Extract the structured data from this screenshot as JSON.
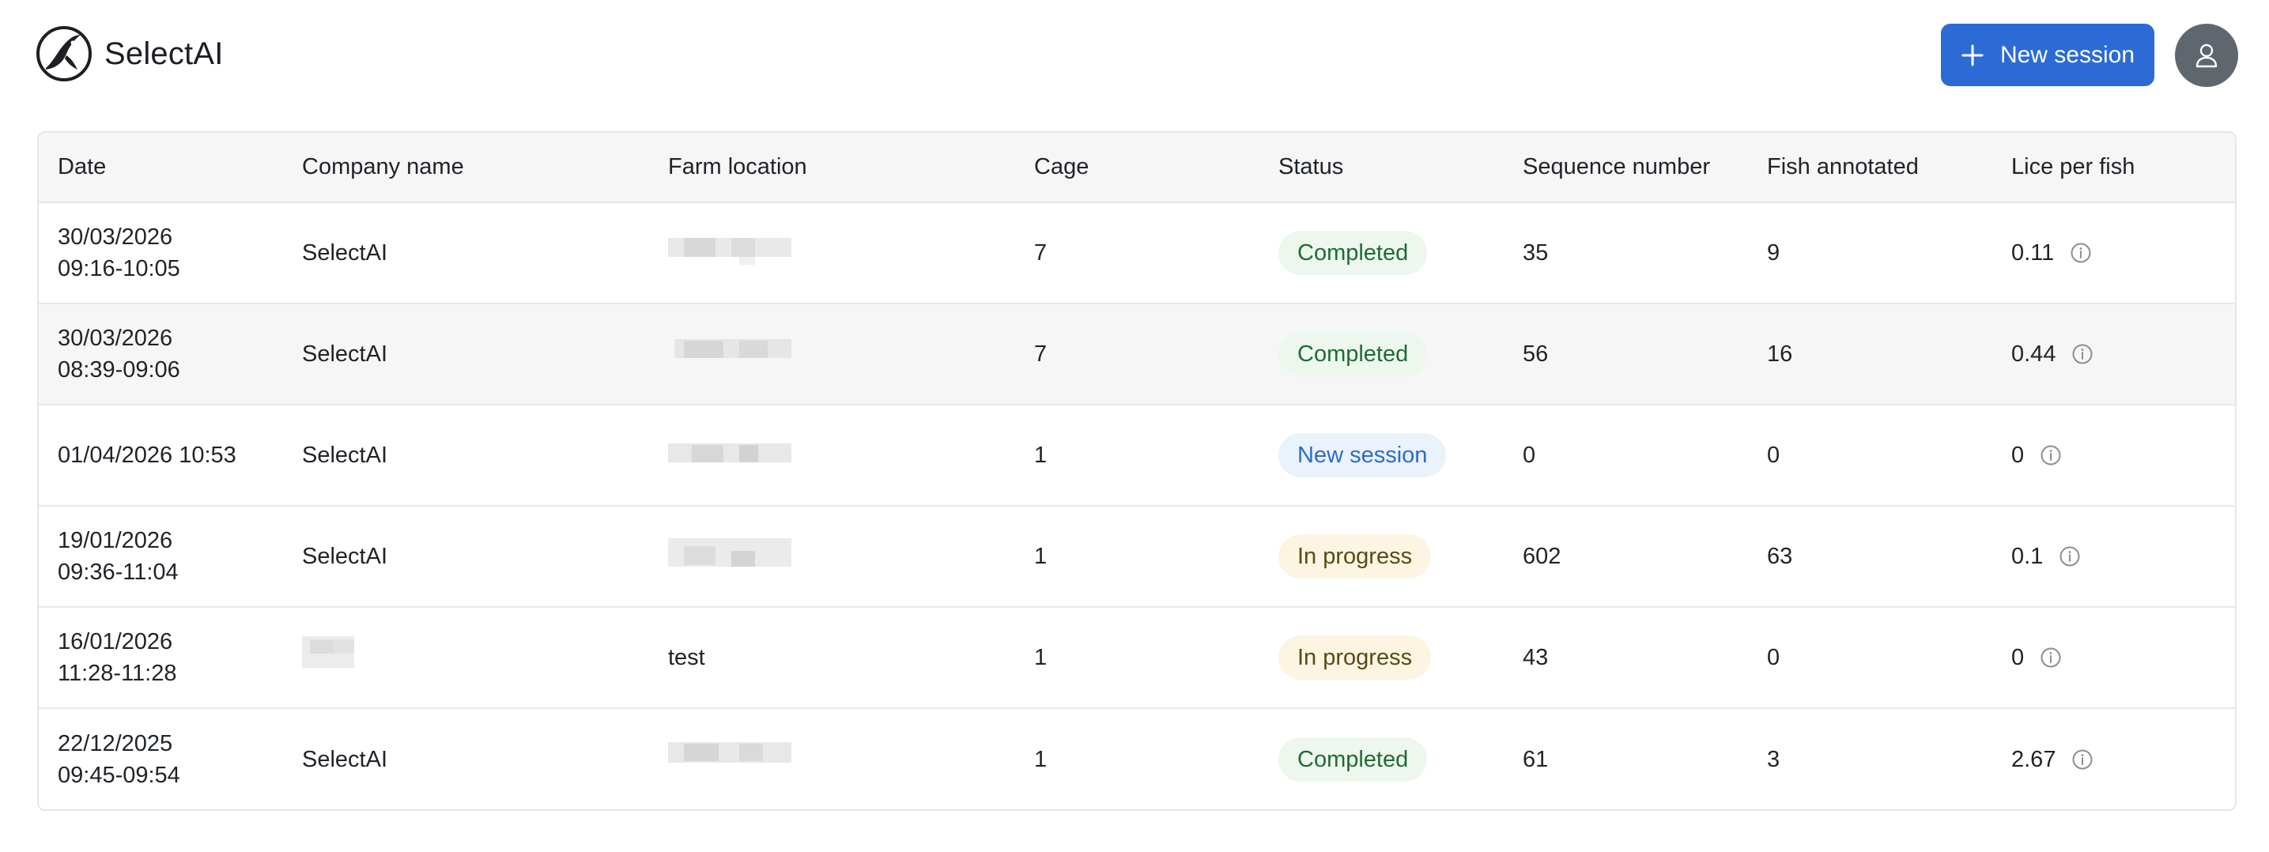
{
  "app": {
    "name": "SelectAI"
  },
  "header": {
    "new_session_label": "New session"
  },
  "table": {
    "columns": [
      "Date",
      "Company name",
      "Farm location",
      "Cage",
      "Status",
      "Sequence number",
      "Fish annotated",
      "Lice per fish"
    ],
    "rows": [
      {
        "date_line1": "30/03/2026",
        "date_line2": "09:16-10:05",
        "company": "SelectAI",
        "farm": "",
        "cage": "7",
        "status": "Completed",
        "sequence": "35",
        "fish": "9",
        "lice": "0.11"
      },
      {
        "date_line1": "30/03/2026",
        "date_line2": "08:39-09:06",
        "company": "SelectAI",
        "farm": "",
        "cage": "7",
        "status": "Completed",
        "sequence": "56",
        "fish": "16",
        "lice": "0.44"
      },
      {
        "date_line1": "01/04/2026 10:53",
        "date_line2": "",
        "company": "SelectAI",
        "farm": "",
        "cage": "1",
        "status": "New session",
        "sequence": "0",
        "fish": "0",
        "lice": "0"
      },
      {
        "date_line1": "19/01/2026",
        "date_line2": "09:36-11:04",
        "company": "SelectAI",
        "farm": "",
        "cage": "1",
        "status": "In progress",
        "sequence": "602",
        "fish": "63",
        "lice": "0.1"
      },
      {
        "date_line1": "16/01/2026",
        "date_line2": "11:28-11:28",
        "company": "",
        "farm": "test",
        "cage": "1",
        "status": "In progress",
        "sequence": "43",
        "fish": "0",
        "lice": "0"
      },
      {
        "date_line1": "22/12/2025",
        "date_line2": "09:45-09:54",
        "company": "SelectAI",
        "farm": "",
        "cage": "1",
        "status": "Completed",
        "sequence": "61",
        "fish": "3",
        "lice": "2.67"
      }
    ]
  },
  "icons": {
    "logo": "fish-logo-icon",
    "add": "plus-icon",
    "user": "user-icon",
    "info": "info-icon"
  },
  "colors": {
    "primary": "#2c6bd6",
    "avatar": "#5f666e",
    "completed_bg": "#edf7ee",
    "completed_text": "#1f6b35",
    "new_bg": "#eaf2fc",
    "new_text": "#2d6cc9",
    "progress_bg": "#fbf5e2",
    "progress_text": "#5a4a16"
  }
}
